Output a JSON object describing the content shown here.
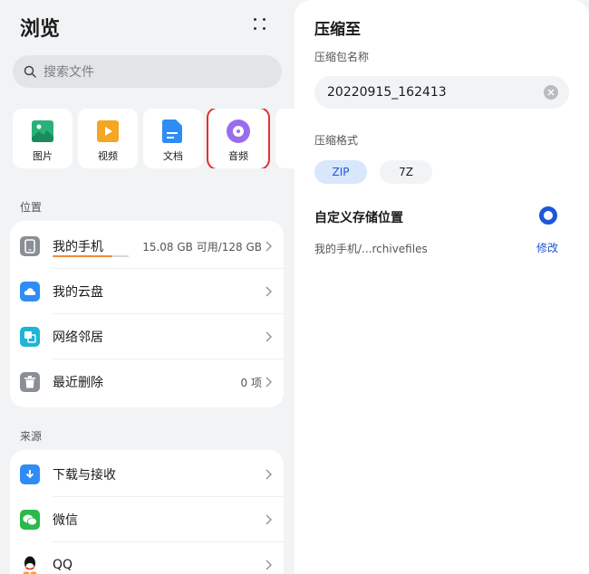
{
  "left": {
    "title": "浏览",
    "search_placeholder": "搜索文件",
    "categories": [
      {
        "label": "图片",
        "icon": "image-icon",
        "color": "#2bb07a"
      },
      {
        "label": "视频",
        "icon": "video-icon",
        "color": "#f5a623"
      },
      {
        "label": "文档",
        "icon": "document-icon",
        "color": "#2f8cf5"
      },
      {
        "label": "音频",
        "icon": "audio-icon",
        "color": "#9b6cf0",
        "selected": true
      }
    ],
    "location_label": "位置",
    "locations": [
      {
        "label": "我的手机",
        "value": "15.08 GB 可用/128 GB",
        "icon": "phone-icon"
      },
      {
        "label": "我的云盘",
        "value": "",
        "icon": "cloud-drive-icon"
      },
      {
        "label": "网络邻居",
        "value": "",
        "icon": "network-icon"
      },
      {
        "label": "最近删除",
        "value": "0 项",
        "icon": "trash-icon"
      }
    ],
    "source_label": "来源",
    "sources": [
      {
        "label": "下载与接收",
        "icon": "download-icon"
      },
      {
        "label": "微信",
        "icon": "wechat-icon"
      },
      {
        "label": "QQ",
        "icon": "qq-icon"
      }
    ]
  },
  "dialog": {
    "title": "压缩至",
    "name_label": "压缩包名称",
    "name_value": "20220915_162413",
    "format_label": "压缩格式",
    "formats": [
      "ZIP",
      "7Z"
    ],
    "selected_format": "ZIP",
    "custom_location_title": "自定义存储位置",
    "path": "我的手机/...rchivefiles",
    "modify_label": "修改"
  },
  "colors": {
    "accent": "#1d56d8",
    "highlight_box": "#e5302c"
  }
}
